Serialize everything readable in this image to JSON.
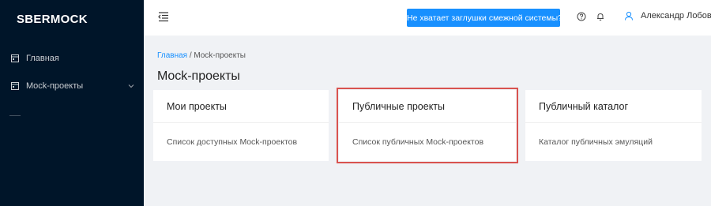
{
  "sidebar": {
    "logo": "SBERMOCK",
    "items": [
      {
        "label": "Главная",
        "icon": "calendar-icon"
      },
      {
        "label": "Mock-проекты",
        "icon": "calendar-icon",
        "expandable": true
      }
    ]
  },
  "header": {
    "cta_label": "Не хватает заглушки смежной системы?",
    "user_name": "Александр Лобов"
  },
  "breadcrumb": {
    "home": "Главная",
    "separator": " / ",
    "current": "Mock-проекты"
  },
  "page": {
    "title": "Mock-проекты",
    "cards": [
      {
        "title": "Мои проекты",
        "description": "Список доступных Mock-проектов",
        "highlighted": false
      },
      {
        "title": "Публичные проекты",
        "description": "Список публичных Mock-проектов",
        "highlighted": true
      },
      {
        "title": "Публичный каталог",
        "description": "Каталог публичных эмуляций",
        "highlighted": false
      }
    ]
  },
  "colors": {
    "sidebar": "#001529",
    "accent": "#1890ff",
    "highlight": "#d9534f",
    "background": "#f0f2f5"
  }
}
